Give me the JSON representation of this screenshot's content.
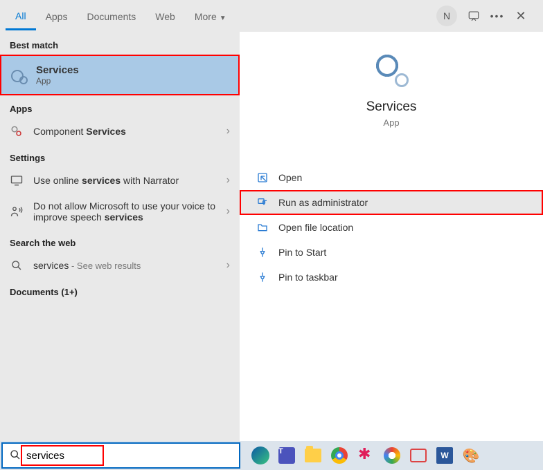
{
  "tabs": {
    "all": "All",
    "apps": "Apps",
    "documents": "Documents",
    "web": "Web",
    "more": "More"
  },
  "titlebar": {
    "avatar_initial": "N"
  },
  "left": {
    "best_match_h": "Best match",
    "best": {
      "title": "Services",
      "sub": "App"
    },
    "apps_h": "Apps",
    "apps": [
      {
        "pre": "Component ",
        "bold": "Services"
      }
    ],
    "settings_h": "Settings",
    "settings": [
      {
        "pre": "Use online ",
        "bold": "services",
        "post": " with Narrator"
      },
      {
        "pre": "Do not allow Microsoft to use your voice to improve speech ",
        "bold": "services",
        "post": ""
      }
    ],
    "web_h": "Search the web",
    "web": {
      "term": "services",
      "hint": " - See web results"
    },
    "docs_h": "Documents (1+)"
  },
  "right": {
    "title": "Services",
    "sub": "App",
    "actions": [
      "Open",
      "Run as administrator",
      "Open file location",
      "Pin to Start",
      "Pin to taskbar"
    ]
  },
  "search": {
    "value": "services"
  }
}
